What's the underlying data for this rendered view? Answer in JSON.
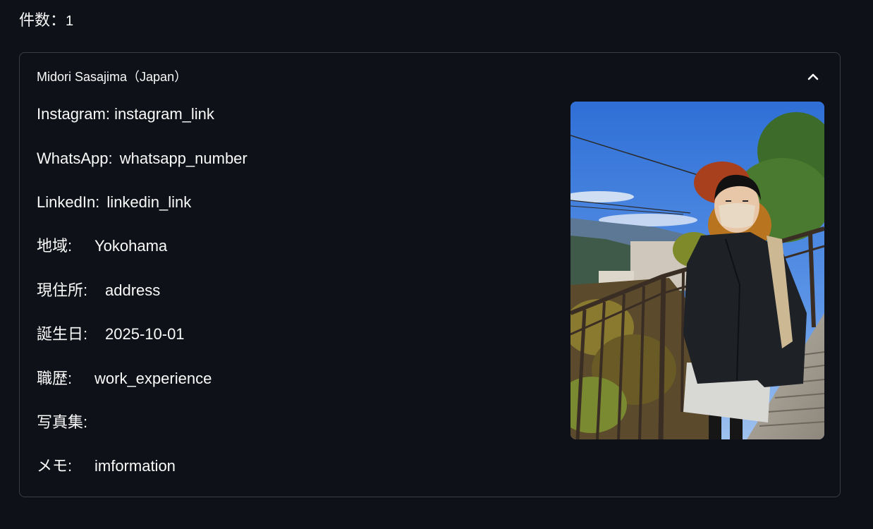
{
  "count": {
    "label": "件数：",
    "value": "1"
  },
  "expander": {
    "title": "Midori Sasajima（Japan）",
    "expanded": true,
    "toggle_icon": "chevron-up-icon"
  },
  "profile": {
    "fields": [
      {
        "label": "Instagram:",
        "value": "instagram_link"
      },
      {
        "label": "WhatsApp:",
        "value": "whatsapp_number"
      },
      {
        "label": "LinkedIn:",
        "value": "linkedin_link"
      },
      {
        "label": "地域:",
        "value": "Yokohama"
      },
      {
        "label": "現住所:",
        "value": "address"
      },
      {
        "label": "誕生日:",
        "value": "2025-10-01"
      },
      {
        "label": "職歴:",
        "value": "work_experience"
      },
      {
        "label": "写真集:",
        "value": ""
      },
      {
        "label": "メモ:",
        "value": "imformation"
      }
    ]
  },
  "photo": {
    "subject": "person-photo"
  },
  "colors": {
    "background": "#0e1117",
    "text": "#fafafa",
    "border": "#3a3d46"
  }
}
